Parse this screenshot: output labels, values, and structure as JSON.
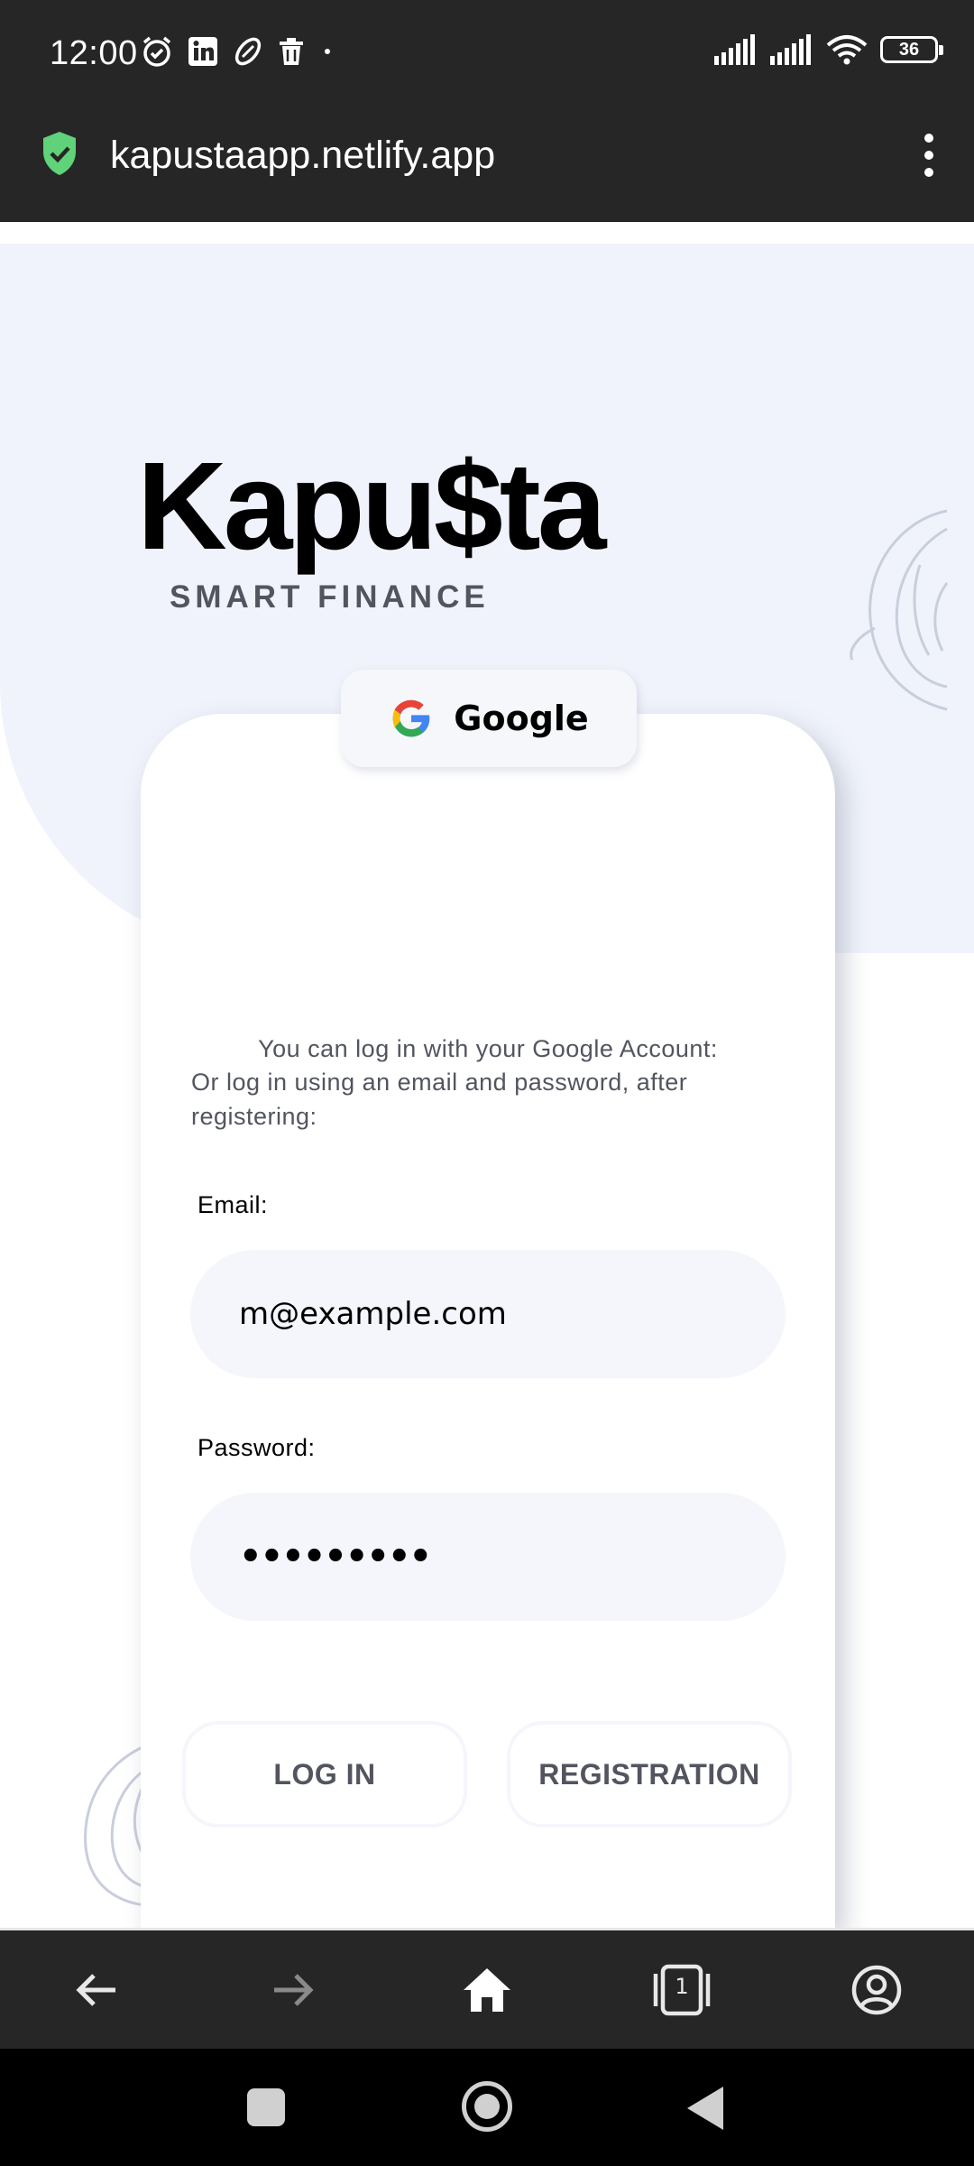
{
  "status_bar": {
    "time": "12:00",
    "battery": "36",
    "left_icons": [
      "alarm-icon",
      "linkedin-icon",
      "paperclip-icon",
      "trash-icon",
      "dot-icon"
    ],
    "right_icons": [
      "signal-icon",
      "signal-icon",
      "wifi-icon",
      "battery-icon"
    ]
  },
  "browser": {
    "url": "kapustaapp.netlify.app",
    "secure_icon": "shield-check-icon",
    "menu_icon": "more-vert-icon",
    "nav_icons": [
      "back-arrow-icon",
      "forward-arrow-icon",
      "home-icon",
      "tabs-icon",
      "account-icon"
    ],
    "tab_count": "1"
  },
  "hero": {
    "logo": "Kapu$ta",
    "tagline": "SMART FINANCE",
    "background_color": "#f0f3fb"
  },
  "login_card": {
    "google_note": "You can log in with your Google Account:",
    "google_button_label": "Google",
    "email_note": "Or log in using an email and password, after registering:",
    "email_label": "Email:",
    "email_value": "m@example.com",
    "password_label": "Password:",
    "password_value": "•••••••••",
    "login_button": "LOG IN",
    "registration_button": "REGISTRATION"
  },
  "colors": {
    "text_primary": "#000000",
    "text_secondary": "#52555f",
    "field_bg": "#f5f6fb",
    "bar_bg": "#262626",
    "secure_green": "#5fd27a"
  }
}
